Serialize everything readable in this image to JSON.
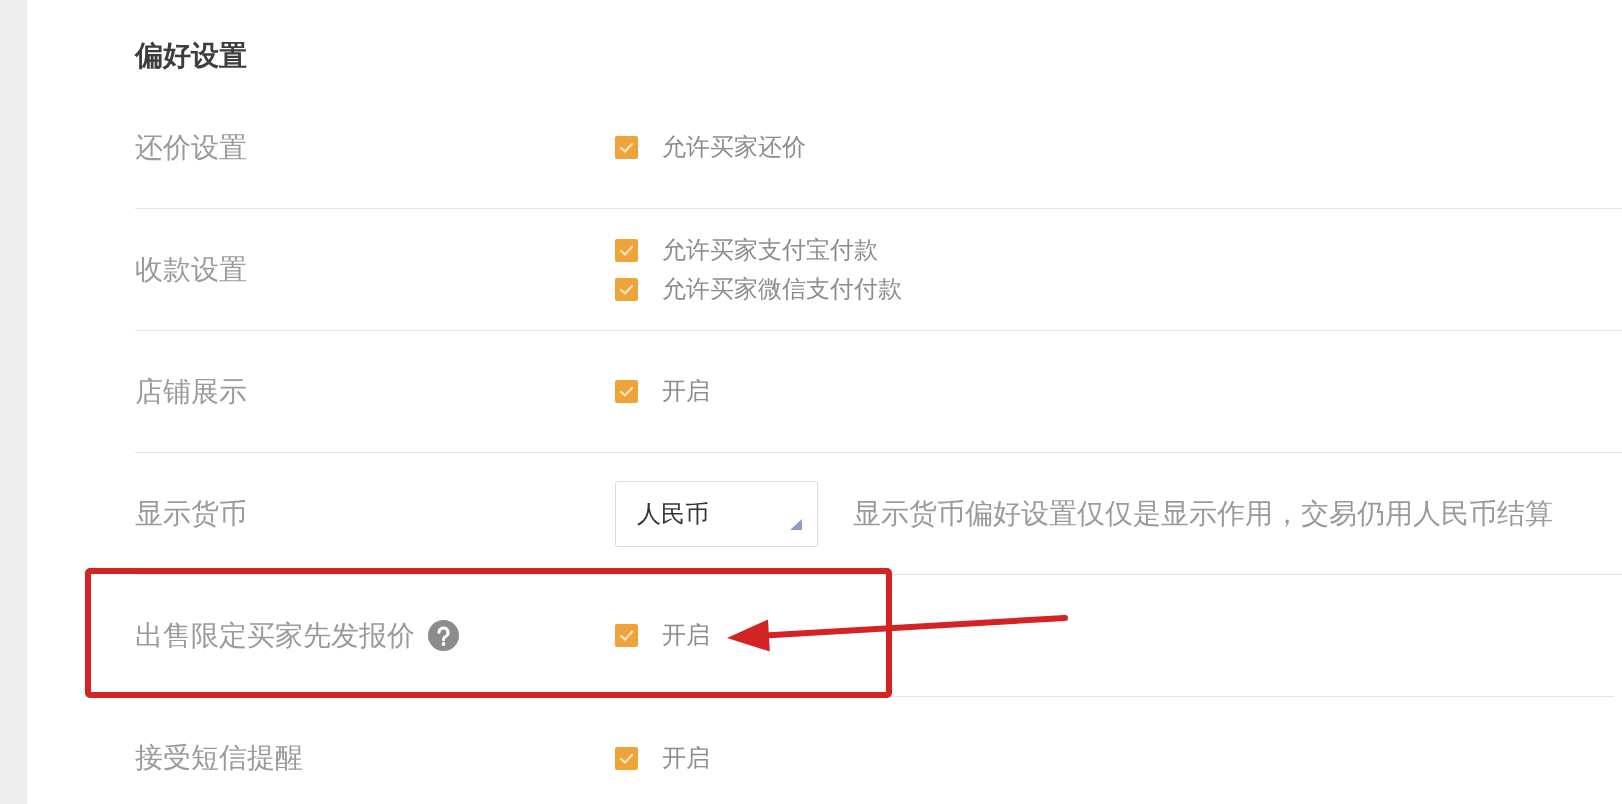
{
  "section_title": "偏好设置",
  "rows": [
    {
      "kind": "checkboxes",
      "label": "还价设置",
      "help": false,
      "highlighted": false,
      "options": [
        {
          "text": "允许买家还价",
          "checked": true
        }
      ]
    },
    {
      "kind": "checkboxes",
      "label": "收款设置",
      "help": false,
      "highlighted": false,
      "options": [
        {
          "text": "允许买家支付宝付款",
          "checked": true
        },
        {
          "text": "允许买家微信支付付款",
          "checked": true
        }
      ]
    },
    {
      "kind": "checkboxes",
      "label": "店铺展示",
      "help": false,
      "highlighted": false,
      "options": [
        {
          "text": "开启",
          "checked": true
        }
      ]
    },
    {
      "kind": "select",
      "label": "显示货币",
      "help": false,
      "highlighted": false,
      "select": {
        "value": "人民币"
      },
      "note": "显示货币偏好设置仅仅是显示作用，交易仍用人民币结算"
    },
    {
      "kind": "checkboxes",
      "label": "出售限定买家先发报价",
      "help": true,
      "highlighted": true,
      "options": [
        {
          "text": "开启",
          "checked": true
        }
      ]
    },
    {
      "kind": "checkboxes",
      "label": "接受短信提醒",
      "help": false,
      "highlighted": false,
      "options": [
        {
          "text": "开启",
          "checked": true
        }
      ]
    }
  ]
}
